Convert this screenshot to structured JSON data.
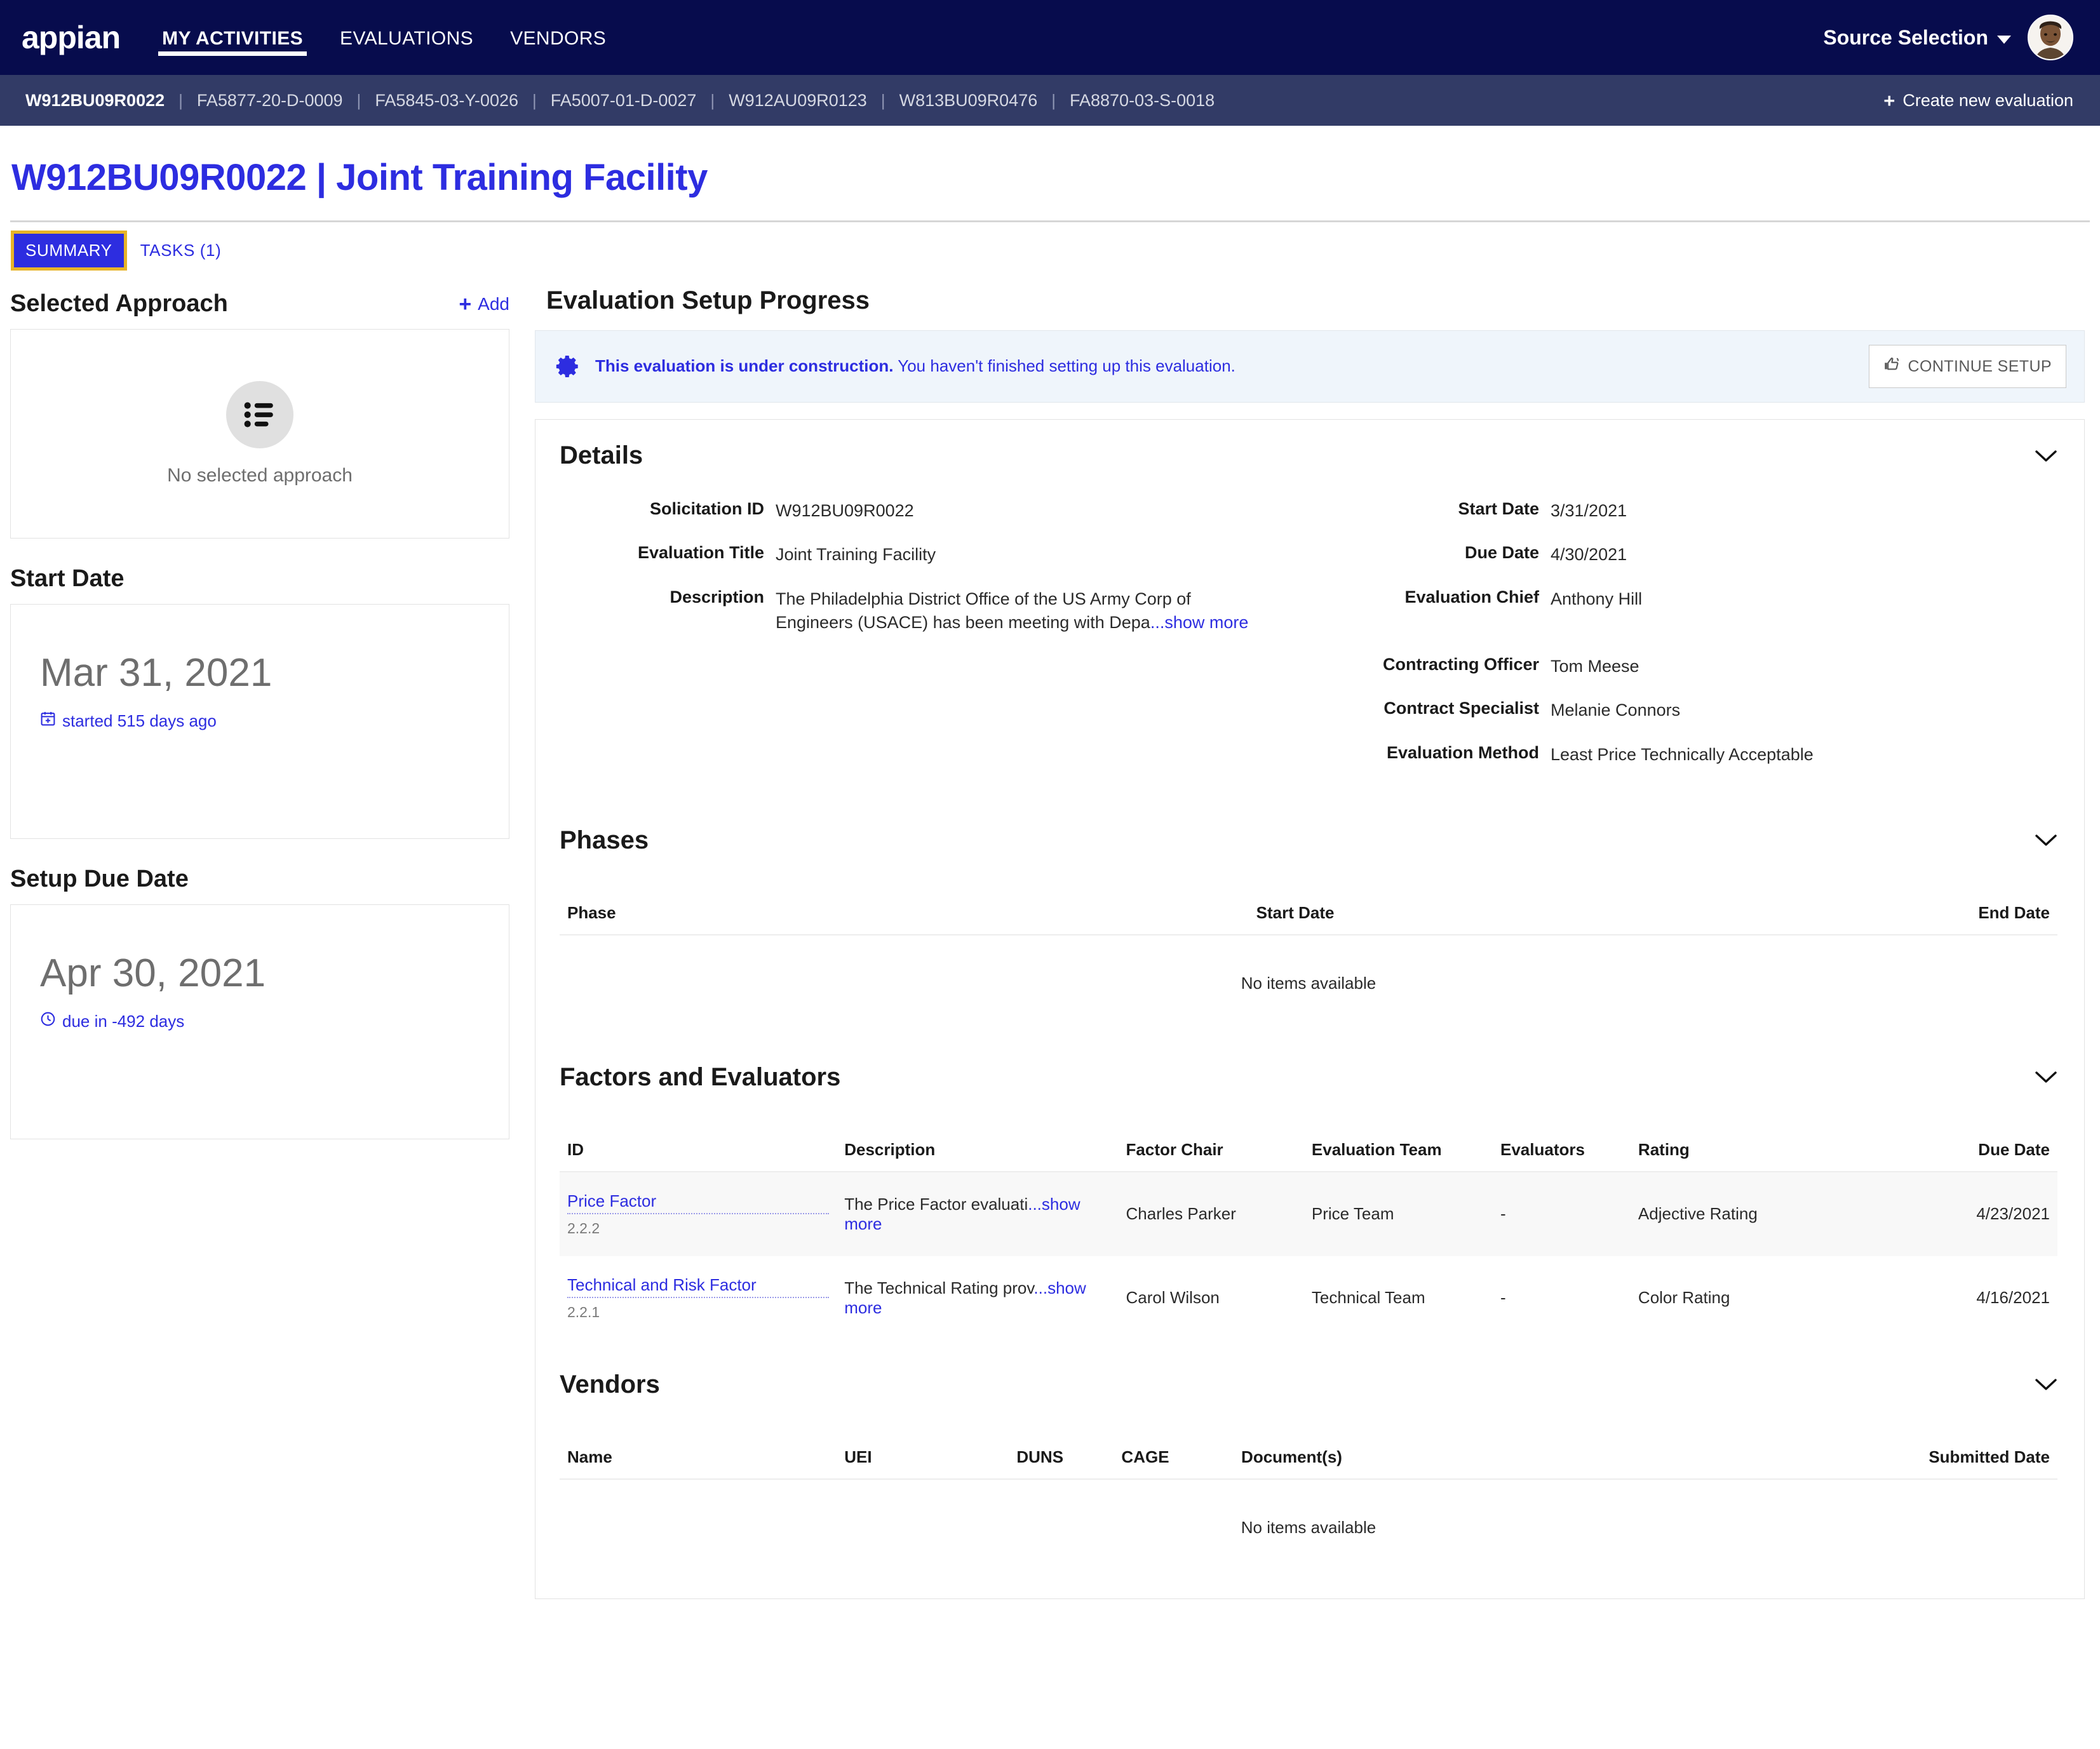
{
  "brand": {
    "logo_text": "appian",
    "accent": "#2D2DE0",
    "nav_bg": "#070C4D",
    "crumb_bg": "#323B66",
    "focus_ring": "#E8B428"
  },
  "topnav": {
    "links": [
      {
        "label": "MY ACTIVITIES",
        "active": true
      },
      {
        "label": "EVALUATIONS",
        "active": false
      },
      {
        "label": "VENDORS",
        "active": false
      }
    ],
    "site_selector": "Source Selection",
    "avatar_name": "user-avatar"
  },
  "crumbbar": {
    "items": [
      "W912BU09R0022",
      "FA5877-20-D-0009",
      "FA5845-03-Y-0026",
      "FA5007-01-D-0027",
      "W912AU09R0123",
      "W813BU09R0476",
      "FA8870-03-S-0018"
    ],
    "separator": "|",
    "create_label": "Create new evaluation",
    "create_plus": "+"
  },
  "page": {
    "title": "W912BU09R0022 | Joint Training Facility",
    "tabs": [
      {
        "label": "SUMMARY",
        "selected": true
      },
      {
        "label": "TASKS (1)",
        "selected": false
      }
    ]
  },
  "left": {
    "selected_approach": {
      "title": "Selected Approach",
      "add_label": "Add",
      "add_plus": "+",
      "empty_text": "No selected approach",
      "empty_icon": "list-icon"
    },
    "start_date": {
      "title": "Start Date",
      "value": "Mar 31, 2021",
      "sub": "started 515 days ago",
      "sub_icon": "calendar-icon"
    },
    "setup_due_date": {
      "title": "Setup Due Date",
      "value": "Apr 30, 2021",
      "sub": "due in -492 days",
      "sub_icon": "clock-icon"
    }
  },
  "right": {
    "heading": "Evaluation Setup Progress",
    "banner": {
      "icon": "gear-icon",
      "bold_text": "This evaluation is under construction.",
      "normal_text": " You haven't finished setting up this evaluation.",
      "button_label": "CONTINUE SETUP",
      "button_icon": "hand-pointer-icon"
    },
    "details": {
      "title": "Details",
      "chevron_icon": "chevron-down-icon",
      "left_fields": [
        {
          "label": "Solicitation ID",
          "value": "W912BU09R0022"
        },
        {
          "label": "Evaluation Title",
          "value": "Joint Training Facility"
        },
        {
          "label": "Description",
          "value": "The Philadelphia District Office of the US Army Corp of Engineers (USACE) has been meeting with Depa",
          "show_more": "...show more"
        }
      ],
      "right_fields": [
        {
          "label": "Start Date",
          "value": "3/31/2021"
        },
        {
          "label": "Due Date",
          "value": "4/30/2021"
        },
        {
          "label": "Evaluation Chief",
          "value": "Anthony Hill"
        },
        {
          "label": "Contracting Officer",
          "value": "Tom Meese"
        },
        {
          "label": "Contract Specialist",
          "value": "Melanie Connors"
        },
        {
          "label": "Evaluation Method",
          "value": "Least Price Technically Acceptable"
        }
      ]
    },
    "phases": {
      "title": "Phases",
      "chevron_icon": "chevron-down-icon",
      "columns": [
        "Phase",
        "Start Date",
        "End Date"
      ],
      "rows": [],
      "empty_text": "No items available"
    },
    "factors": {
      "title": "Factors and Evaluators",
      "chevron_icon": "chevron-down-icon",
      "columns": [
        "ID",
        "Description",
        "Factor Chair",
        "Evaluation Team",
        "Evaluators",
        "Rating",
        "Due Date"
      ],
      "rows": [
        {
          "id_link": "Price Factor",
          "id_sub": "2.2.2",
          "description": "The Price Factor evaluati",
          "show_more": "...show more",
          "factor_chair": "Charles Parker",
          "evaluation_team": "Price Team",
          "evaluators": "-",
          "rating": "Adjective Rating",
          "due_date": "4/23/2021"
        },
        {
          "id_link": "Technical and Risk Factor",
          "id_sub": "2.2.1",
          "description": "The Technical Rating prov",
          "show_more": "...show more",
          "factor_chair": "Carol Wilson",
          "evaluation_team": "Technical Team",
          "evaluators": "-",
          "rating": "Color Rating",
          "due_date": "4/16/2021"
        }
      ]
    },
    "vendors": {
      "title": "Vendors",
      "chevron_icon": "chevron-down-icon",
      "columns": [
        "Name",
        "UEI",
        "DUNS",
        "CAGE",
        "Document(s)",
        "Submitted Date"
      ],
      "rows": [],
      "empty_text": "No items available"
    }
  }
}
